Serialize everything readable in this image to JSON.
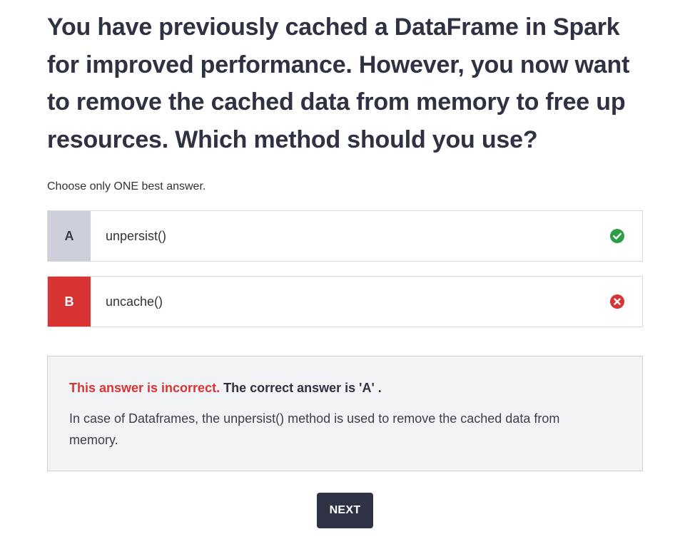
{
  "question": {
    "text": "You have previously cached a DataFrame in Spark for improved performance. However, you now want to remove the cached data from memory to free up resources. Which method should you use?"
  },
  "instructions": "Choose only ONE best answer.",
  "options": [
    {
      "letter": "A",
      "text": "unpersist()",
      "status": "correct",
      "status_icon": "check-circle-icon",
      "status_color": "#2e9e46"
    },
    {
      "letter": "B",
      "text": "uncache()",
      "status": "selected-incorrect",
      "status_icon": "x-circle-icon",
      "status_color": "#d93434"
    }
  ],
  "feedback": {
    "incorrect_label": "This answer is incorrect.",
    "correct_answer_label": "The correct answer is 'A' .",
    "explanation": "In case of Dataframes, the unpersist() method is used to remove the cached data from memory."
  },
  "next_button": {
    "label": "NEXT"
  },
  "colors": {
    "incorrect": "#d93434",
    "correct": "#2e9e46",
    "primary_button": "#2f3245"
  }
}
